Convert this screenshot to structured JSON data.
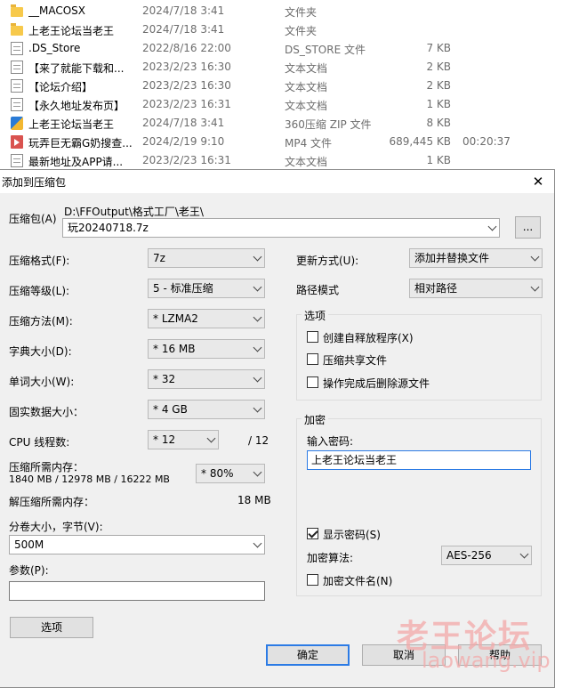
{
  "file_list": [
    {
      "name": "__MACOSX",
      "date": "2024/7/18 3:41",
      "type": "文件夹",
      "size": "",
      "duration": "",
      "icon": "folder-icon"
    },
    {
      "name": "上老王论坛当老王",
      "date": "2024/7/18 3:41",
      "type": "文件夹",
      "size": "",
      "duration": "",
      "icon": "folder-icon"
    },
    {
      "name": ".DS_Store",
      "date": "2022/8/16 22:00",
      "type": "DS_STORE 文件",
      "size": "7 KB",
      "duration": "",
      "icon": "document-icon"
    },
    {
      "name": "【来了就能下载和...",
      "date": "2023/2/23 16:30",
      "type": "文本文档",
      "size": "2 KB",
      "duration": "",
      "icon": "text-document-icon"
    },
    {
      "name": "【论坛介绍】",
      "date": "2023/2/23 16:30",
      "type": "文本文档",
      "size": "2 KB",
      "duration": "",
      "icon": "text-document-icon"
    },
    {
      "name": "【永久地址发布页】",
      "date": "2023/2/23 16:31",
      "type": "文本文档",
      "size": "1 KB",
      "duration": "",
      "icon": "text-document-icon"
    },
    {
      "name": "上老王论坛当老王",
      "date": "2024/7/18 3:41",
      "type": "360压缩 ZIP 文件",
      "size": "8 KB",
      "duration": "",
      "icon": "zip-archive-icon"
    },
    {
      "name": "玩弄巨无霸G奶搜查...",
      "date": "2024/2/19 9:10",
      "type": "MP4 文件",
      "size": "689,445 KB",
      "duration": "00:20:37",
      "icon": "video-file-icon"
    },
    {
      "name": "最新地址及APP请...",
      "date": "2023/2/23 16:31",
      "type": "文本文档",
      "size": "1 KB",
      "duration": "",
      "icon": "text-document-icon"
    }
  ],
  "dialog": {
    "title": "添加到压缩包",
    "close": "✕",
    "archive_label": "压缩包(A)",
    "archive_path": "D:\\FFOutput\\格式工厂\\老王\\",
    "archive_name": "玩20240718.7z",
    "browse_label": "...",
    "format_label": "压缩格式(F):",
    "format_value": "7z",
    "level_label": "压缩等级(L):",
    "level_value": "5 - 标准压缩",
    "method_label": "压缩方法(M):",
    "method_value": "* LZMA2",
    "dict_label": "字典大小(D):",
    "dict_value": "* 16 MB",
    "word_label": "单词大小(W):",
    "word_value": "* 32",
    "solid_label": "固实数据大小：",
    "solid_value": "* 4 GB",
    "threads_label": "CPU 线程数:",
    "threads_value": "* 12",
    "threads_max": "/ 12",
    "mem_comp_label": "压缩所需内存：",
    "mem_comp_value": "1840 MB / 12978 MB / 16222 MB",
    "mem_percent": "* 80%",
    "mem_decomp_label": "解压缩所需内存：",
    "mem_decomp_value": "18 MB",
    "volume_label": "分卷大小，字节(V):",
    "volume_value": "500M",
    "params_label": "参数(P):",
    "params_value": "",
    "options_button": "选项",
    "update_label": "更新方式(U):",
    "update_value": "添加并替换文件",
    "path_label": "路径模式",
    "path_value": "相对路径",
    "options_group": "选项",
    "opt_sfx": "创建自释放程序(X)",
    "opt_shared": "压缩共享文件",
    "opt_delete": "操作完成后删除源文件",
    "encrypt_group": "加密",
    "password_label": "输入密码:",
    "password_value": "上老王论坛当老王",
    "show_password": "显示密码(S)",
    "enc_method_label": "加密算法:",
    "enc_method_value": "AES-256",
    "enc_names": "加密文件名(N)",
    "ok": "确定",
    "cancel": "取消",
    "help": "帮助"
  },
  "watermark": {
    "text": "老王论坛",
    "url": "laowang.vip"
  }
}
